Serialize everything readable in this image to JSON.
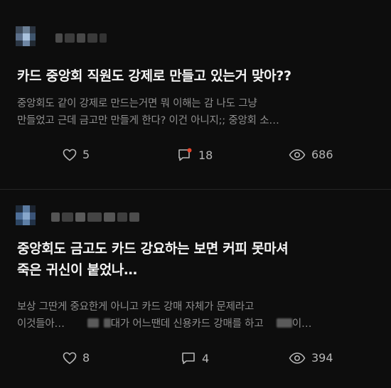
{
  "posts": [
    {
      "title": "카드 중앙회 직원도 강제로 만들고 있는거 맞아??",
      "preview_line1": "중앙회도 같이 강제로 만드는거면 뭐 이해는 감 나도 그냥",
      "preview_line2": "만들었고  근데 금고만 만들게 한다? 이건 아니지;;  중앙회 소…",
      "likes": "5",
      "comments": "18",
      "views": "686",
      "has_new_comment": true
    },
    {
      "title_line1": "중앙회도 금고도 카드 강요하는 보면 커피 못마셔",
      "title_line2": "죽은 귀신이 붙었나…",
      "preview_line1": "보상 그딴게 중요한게 아니고 카드 강매 자체가 문제라고",
      "preview_line2_a": "이것들아…",
      "preview_line2_b": "대가 어느땐데 신용카드 강매를 하고",
      "preview_line2_c": "이…",
      "likes": "8",
      "comments": "4",
      "views": "394",
      "has_new_comment": false
    }
  ],
  "icons": {
    "like": "heart-outline-icon",
    "comment": "comment-bubble-icon",
    "views": "eye-icon"
  },
  "colors": {
    "background": "#0d0d0d",
    "title": "#f4f4f4",
    "preview": "#8e8e8e",
    "stat": "#b5b5b5",
    "new_dot": "#e8452c"
  }
}
